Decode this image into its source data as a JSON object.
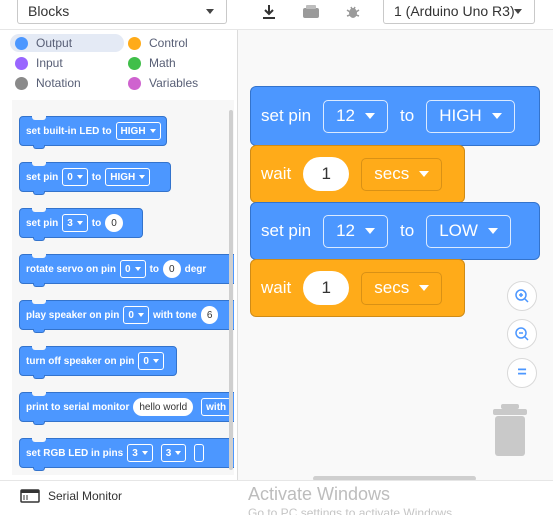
{
  "topbar": {
    "category_select": "Blocks",
    "board_select": "1 (Arduino Uno R3)",
    "icons": [
      "download-icon",
      "device-icon",
      "bug-icon"
    ]
  },
  "categories": [
    {
      "label": "Output",
      "color": "#4c97ff",
      "selected": true
    },
    {
      "label": "Control",
      "color": "#ffab19"
    },
    {
      "label": "Input",
      "color": "#9966ff"
    },
    {
      "label": "Math",
      "color": "#40bf4a"
    },
    {
      "label": "Notation",
      "color": "#8a8a8a"
    },
    {
      "label": "Variables",
      "color": "#cf63cf"
    }
  ],
  "palette": {
    "b1": {
      "text": "set built-in LED to",
      "dd": "HIGH"
    },
    "b2": {
      "t1": "set pin",
      "dd1": "0",
      "t2": "to",
      "dd2": "HIGH"
    },
    "b3": {
      "t1": "set pin",
      "dd1": "3",
      "t2": "to",
      "v": "0"
    },
    "b4": {
      "t1": "rotate servo on pin",
      "dd1": "0",
      "t2": "to",
      "v": "0",
      "t3": "degr"
    },
    "b5": {
      "t1": "play speaker on pin",
      "dd1": "0",
      "t2": "with tone",
      "v": "6"
    },
    "b6": {
      "t1": "turn off speaker on pin",
      "dd1": "0"
    },
    "b7": {
      "t1": "print to serial monitor",
      "v": "hello world",
      "t2": "with"
    },
    "b8": {
      "t1": "set RGB LED in pins",
      "dd1": "3",
      "dd2": "3"
    }
  },
  "workspace": {
    "blocks": [
      {
        "t1": "set pin",
        "dd1": "12",
        "t2": "to",
        "dd2": "HIGH",
        "color": "#4c97ff"
      },
      {
        "t1": "wait",
        "v": "1",
        "dd": "secs",
        "color": "#ffab19"
      },
      {
        "t1": "set pin",
        "dd1": "12",
        "t2": "to",
        "dd2": "LOW",
        "color": "#4c97ff"
      },
      {
        "t1": "wait",
        "v": "1",
        "dd": "secs",
        "color": "#ffab19"
      }
    ],
    "zoom_buttons": [
      "zoom-in",
      "zoom-out",
      "zoom-reset"
    ],
    "zoom_reset_label": "="
  },
  "footer": {
    "serial_monitor": "Serial Monitor",
    "watermark_title": "Activate Windows",
    "watermark_sub": "Go to PC settings to activate Windows."
  }
}
